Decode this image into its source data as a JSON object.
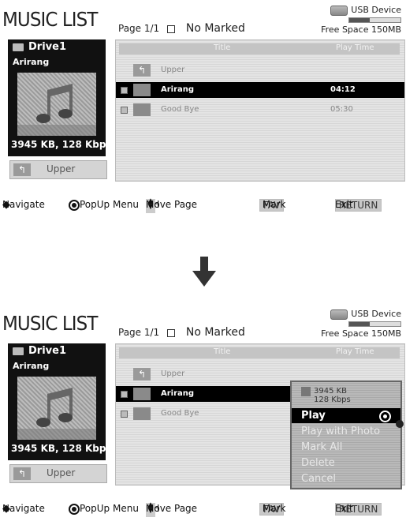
{
  "title": "MUSIC LIST",
  "page_info": {
    "page": "Page 1/1",
    "marked": "No Marked"
  },
  "usb": {
    "device": "USB Device",
    "free_space": "Free Space 150MB",
    "usage_fraction": 0.4
  },
  "left_panel": {
    "drive": "Drive1",
    "song": "Arirang",
    "info": "3945 KB, 128 Kbps",
    "upper_button": "Upper"
  },
  "list": {
    "header": {
      "title": "Title",
      "play_time": "Play Time"
    },
    "upper_row": "Upper",
    "rows": [
      {
        "name": "Arirang",
        "time": "04:12",
        "selected": true
      },
      {
        "name": "Good Bye",
        "time": "05:30",
        "selected": false
      }
    ]
  },
  "popup": {
    "info_size": "3945 KB",
    "info_rate": "128 Kbps",
    "items": [
      "Play",
      "Play with Photo",
      "Mark All",
      "Delete",
      "Cancel"
    ],
    "selected": "Play"
  },
  "footer": {
    "navigate": "Navigate",
    "popup_menu": "PopUp Menu",
    "ch": "CH",
    "move_page": "Move Page",
    "fav": "FAV",
    "mark": "Mark",
    "return": "RETURN",
    "exit": "Exit"
  }
}
